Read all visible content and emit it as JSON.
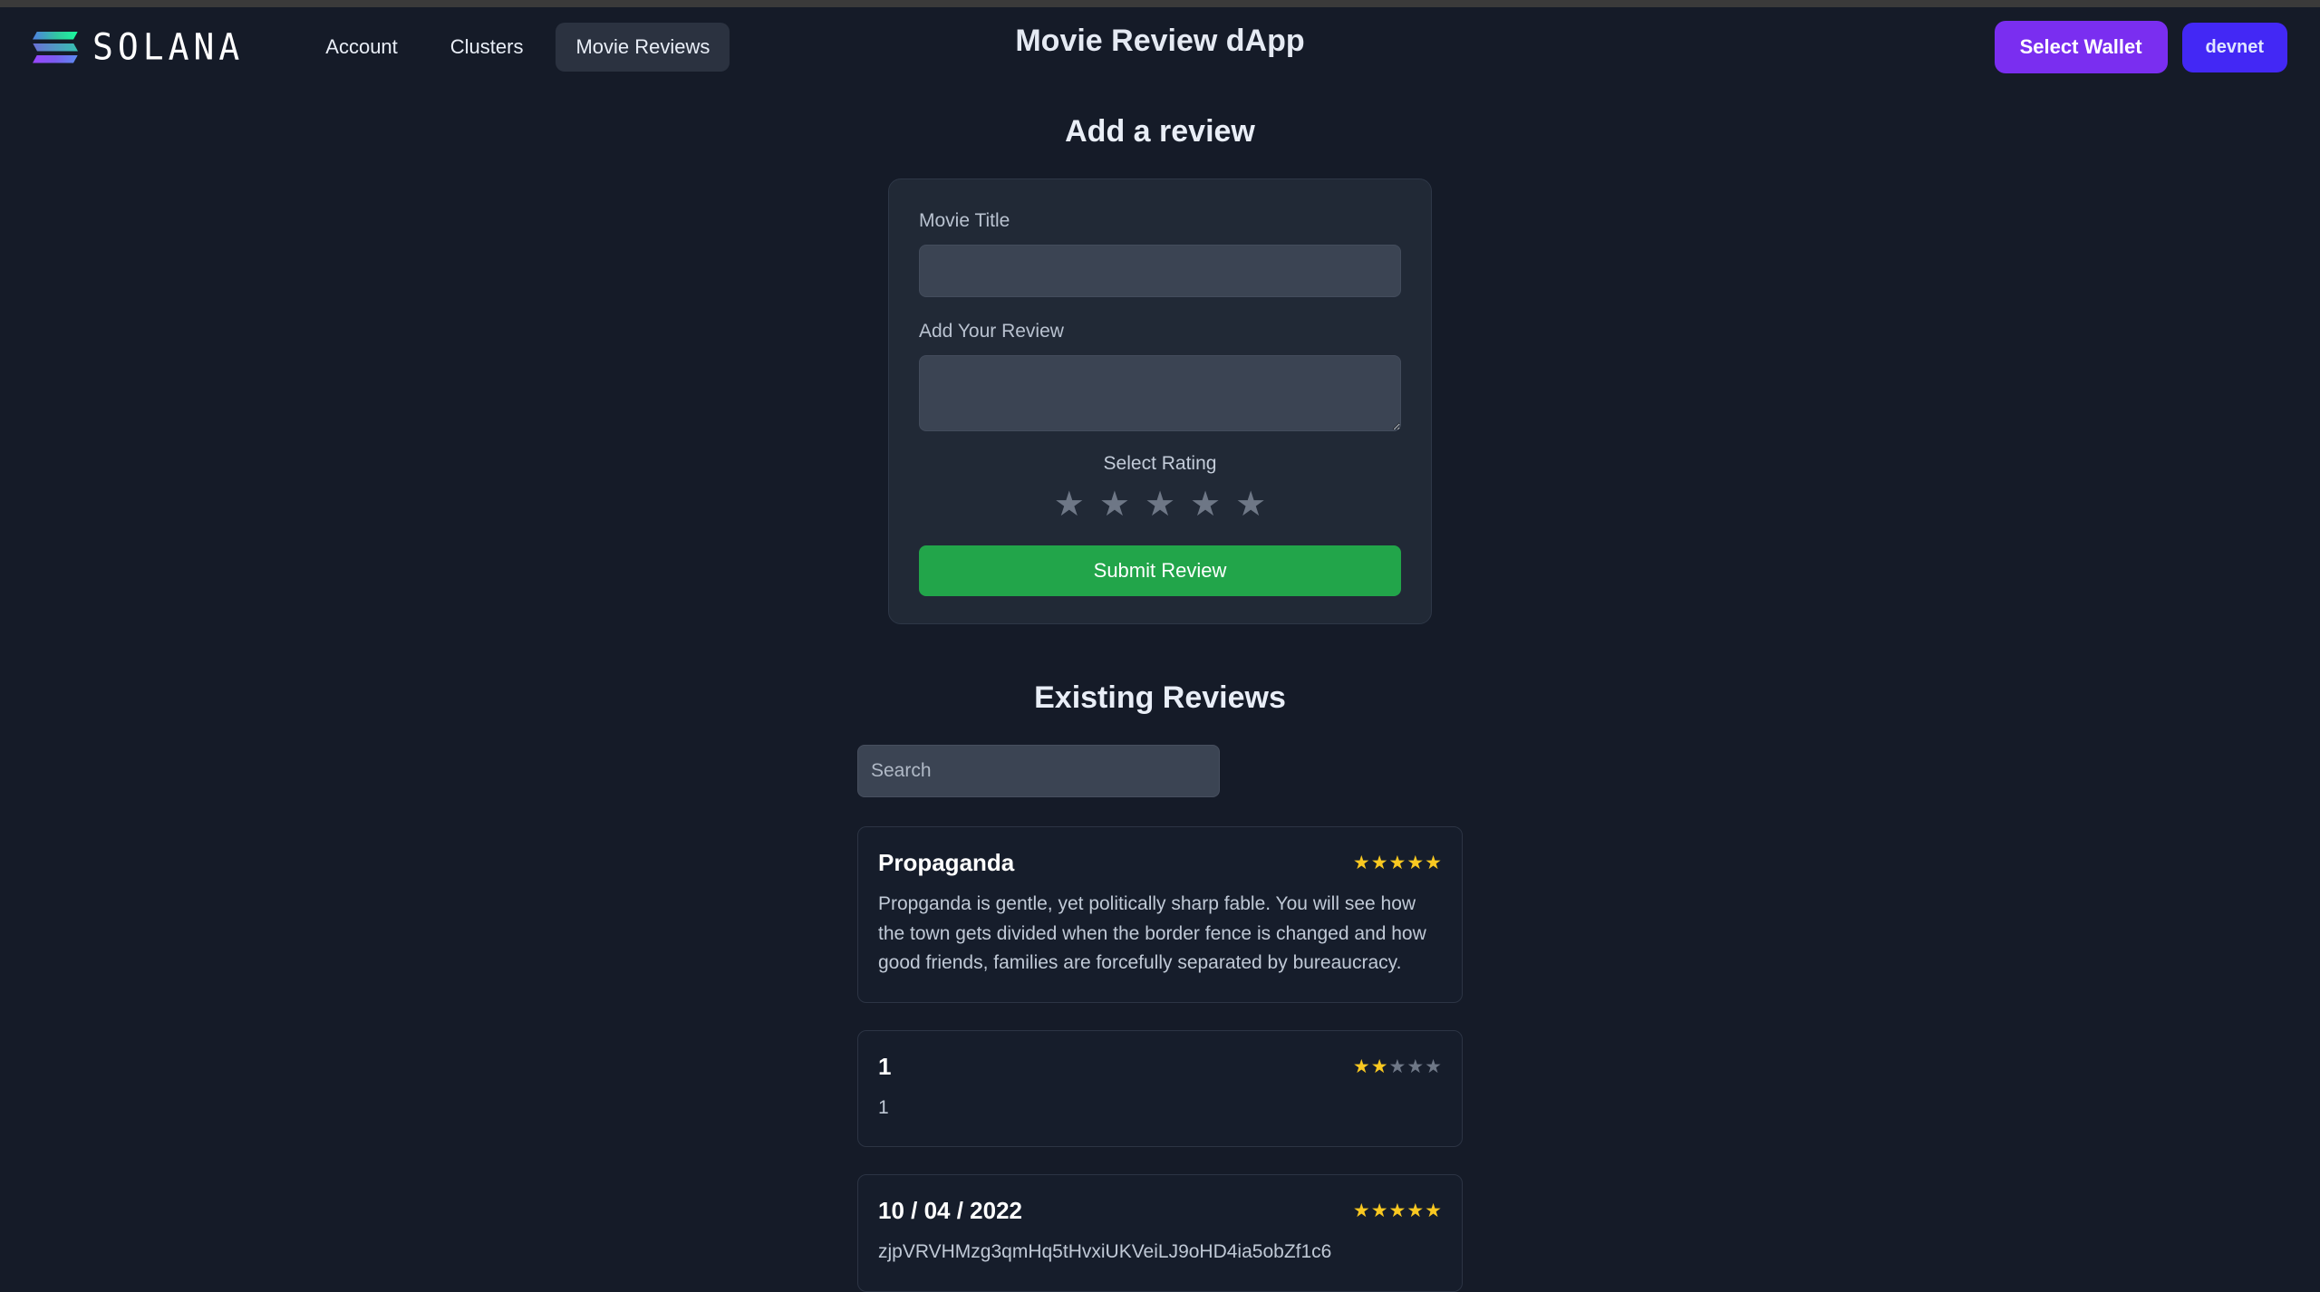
{
  "header": {
    "brand_word": "SOLANA",
    "brand_icon": "solana-logo-icon",
    "page_title": "Movie Review dApp",
    "nav_links": [
      {
        "label": "Account",
        "active": false
      },
      {
        "label": "Clusters",
        "active": false
      },
      {
        "label": "Movie Reviews",
        "active": true
      }
    ],
    "wallet_button": "Select Wallet",
    "network_button": "devnet"
  },
  "add_review": {
    "heading": "Add a review",
    "title_label": "Movie Title",
    "title_value": "",
    "title_placeholder": "",
    "review_label": "Add Your Review",
    "review_value": "",
    "review_placeholder": "",
    "rating_label": "Select Rating",
    "rating_stars_total": 5,
    "rating_selected": 0,
    "star_glyph": "★",
    "submit_label": "Submit Review"
  },
  "existing_reviews": {
    "heading": "Existing Reviews",
    "search_value": "",
    "search_placeholder": "Search",
    "items": [
      {
        "title": "Propaganda",
        "rating": 5,
        "stars_total": 5,
        "body": "Propganda is gentle, yet politically sharp fable. You will see how the town gets divided when the border fence is changed and how good friends, families are forcefully separated by bureaucracy."
      },
      {
        "title": "1",
        "rating": 2,
        "stars_total": 5,
        "body": "1"
      },
      {
        "title": "10 / 04 / 2022",
        "rating": 5,
        "stars_total": 5,
        "body": "zjpVRVHMzg3qmHq5tHvxiUKVeiLJ9oHD4ia5obZf1c6"
      }
    ]
  },
  "colors": {
    "page_bg": "#151b28",
    "card_bg": "#212936",
    "input_bg": "#3b4453",
    "wallet_purple": "#7a2ef0",
    "network_blue": "#4328f5",
    "submit_green": "#22a54a",
    "star_on": "#f9c821",
    "star_off": "#6e7786"
  }
}
